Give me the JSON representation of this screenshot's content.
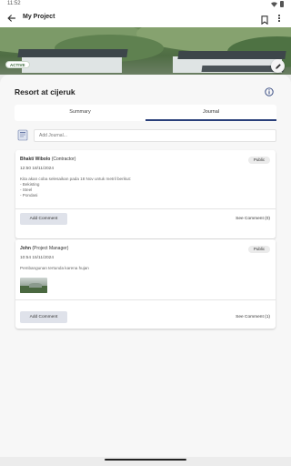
{
  "status_bar": {
    "time": "11:52"
  },
  "app_bar": {
    "title": "My Project"
  },
  "hero": {
    "status_badge": "ACTIVE"
  },
  "project": {
    "name": "Resort at cijeruk"
  },
  "tabs": [
    {
      "label": "Summary",
      "selected": false
    },
    {
      "label": "Journal",
      "selected": true
    }
  ],
  "add_journal": {
    "placeholder": "Add Journal..."
  },
  "journals": [
    {
      "author_name": "Bhakti Wibolo",
      "author_role": "(Contractor)",
      "visibility": "Public",
      "timestamp": "12:50 18/11/2024",
      "body_lines": [
        "Kita akan coba selesaikan pada 18 Nov untuk metril berikut:",
        "- Bekisting",
        "- Steel",
        "- Pondasi"
      ],
      "add_comment_label": "Add Comment",
      "see_comment_label": "See Comment (0)"
    },
    {
      "author_name": "John",
      "author_role": "(Project Manager)",
      "visibility": "Public",
      "timestamp": "10:54 15/11/2024",
      "body_lines": [
        "Pembangunan tertunda karena hujan"
      ],
      "has_image": true,
      "add_comment_label": "Add Comment",
      "see_comment_label": "See Comment (1)"
    }
  ],
  "colors": {
    "accent": "#2a3f7a",
    "button_bg": "#dfe2ea",
    "badge_text": "#3f6d3f"
  }
}
